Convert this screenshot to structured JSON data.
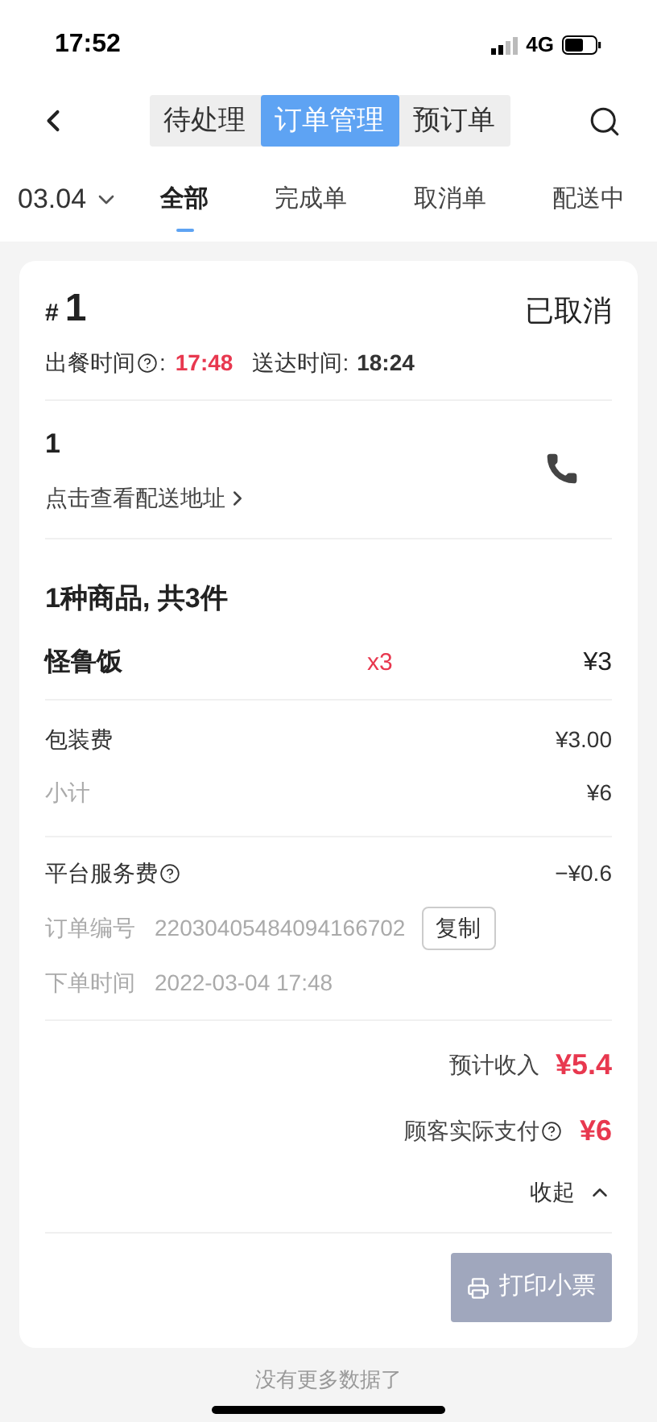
{
  "status_bar": {
    "time": "17:52",
    "network": "4G"
  },
  "segments": [
    {
      "label": "待处理",
      "selected": false
    },
    {
      "label": "订单管理",
      "selected": true
    },
    {
      "label": "预订单",
      "selected": false
    }
  ],
  "date_filter": "03.04",
  "filter_tabs": [
    {
      "label": "全部",
      "selected": true
    },
    {
      "label": "完成单",
      "selected": false
    },
    {
      "label": "取消单",
      "selected": false
    },
    {
      "label": "配送中",
      "selected": false
    }
  ],
  "order": {
    "hash": "#",
    "number": "1",
    "status": "已取消",
    "meal_time_label": "出餐时间",
    "meal_time_colon": ":",
    "meal_time": "17:48",
    "delivery_time_label": "送达时间:",
    "delivery_time": "18:24",
    "customer": "1",
    "address_link": "点击查看配送地址",
    "items_heading": "1种商品, 共3件",
    "items": [
      {
        "name": "怪鲁饭",
        "qty": "x3",
        "price": "¥3"
      }
    ],
    "fees": [
      {
        "label": "包装费",
        "value": "¥3.00",
        "muted": false
      },
      {
        "label": "小计",
        "value": "¥6",
        "muted": true
      }
    ],
    "platform_fee": {
      "label": "平台服务费",
      "value": "−¥0.6"
    },
    "order_no": {
      "label": "订单编号",
      "value": "22030405484094166702",
      "copy": "复制"
    },
    "order_time": {
      "label": "下单时间",
      "value": "2022-03-04 17:48"
    },
    "expected_income": {
      "label": "预计收入",
      "value": "¥5.4"
    },
    "paid": {
      "label": "顾客实际支付",
      "value": "¥6"
    },
    "collapse": {
      "label": "收起",
      "expanded": true
    },
    "print_button": {
      "label": "打印小票",
      "disabled": true
    }
  },
  "footer": "没有更多数据了"
}
